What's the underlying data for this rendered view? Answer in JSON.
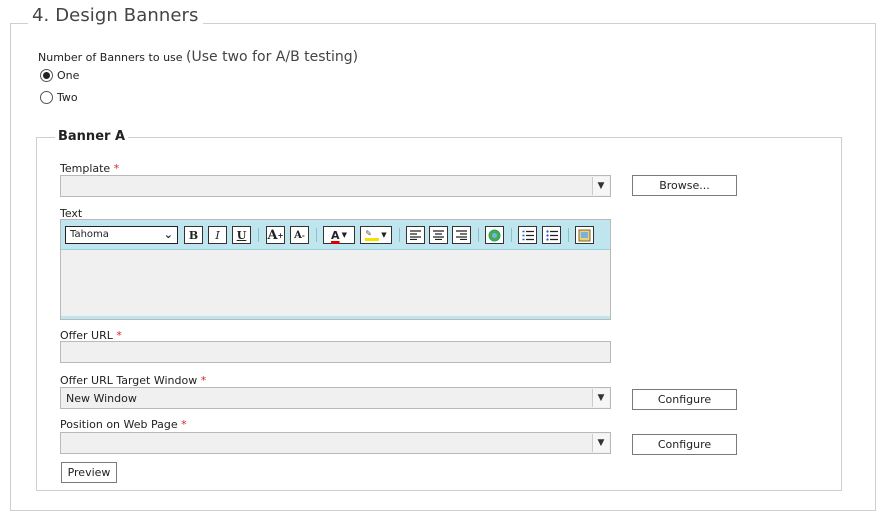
{
  "section": {
    "title": "4. Design Banners"
  },
  "banner_count": {
    "label": "Number of Banners to use",
    "hint": "(Use two for A/B testing)",
    "options": [
      {
        "label": "One",
        "checked": true
      },
      {
        "label": "Two",
        "checked": false
      }
    ]
  },
  "banner_a": {
    "title": "Banner A",
    "template": {
      "label": "Template",
      "value": "",
      "button": "Browse..."
    },
    "text": {
      "label": "Text",
      "font": "Tahoma",
      "toolbar": {
        "bold": "B",
        "italic": "I",
        "underline": "U",
        "grow_font": "A",
        "shrink_font": "A",
        "font_color": "A"
      }
    },
    "offer_url": {
      "label": "Offer URL",
      "value": ""
    },
    "target_window": {
      "label": "Offer URL Target Window",
      "value": "New Window",
      "button": "Configure"
    },
    "position": {
      "label": "Position on Web Page",
      "value": "",
      "button": "Configure"
    },
    "preview_button": "Preview"
  },
  "required_marker": "*"
}
